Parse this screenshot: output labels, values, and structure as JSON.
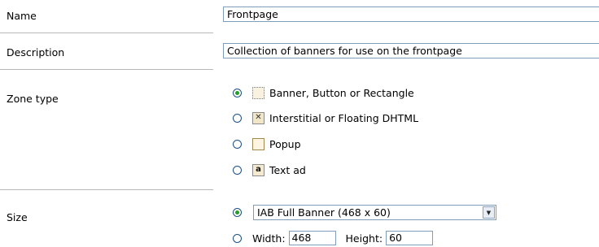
{
  "form": {
    "name": {
      "label": "Name",
      "value": "Frontpage"
    },
    "description": {
      "label": "Description",
      "value": "Collection of banners for use on the frontpage"
    },
    "zone_type": {
      "label": "Zone type",
      "options": [
        {
          "label": "Banner, Button or Rectangle",
          "selected": true,
          "icon": "banner-icon"
        },
        {
          "label": "Interstitial or Floating DHTML",
          "selected": false,
          "icon": "interstitial-icon"
        },
        {
          "label": "Popup",
          "selected": false,
          "icon": "popup-icon"
        },
        {
          "label": "Text ad",
          "selected": false,
          "icon": "text-ad-icon"
        }
      ]
    },
    "size": {
      "label": "Size",
      "preset": {
        "selected": true,
        "value": "IAB Full Banner (468 x 60)"
      },
      "custom": {
        "selected": false,
        "width_label": "Width:",
        "width_value": "468",
        "height_label": "Height:",
        "height_value": "60"
      }
    }
  }
}
